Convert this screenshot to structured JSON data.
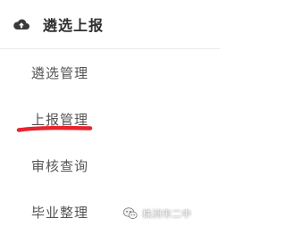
{
  "menu": {
    "header": {
      "icon": "cloud-upload-icon",
      "label": "遴选上报"
    },
    "items": [
      {
        "label": "遴选管理"
      },
      {
        "label": "上报管理",
        "annotated": true
      },
      {
        "label": "审核查询"
      },
      {
        "label": "毕业整理"
      }
    ]
  },
  "annotation": {
    "color": "#e8242f",
    "shape": "underline"
  },
  "watermark": {
    "icon": "wechat-icon",
    "text": "株洲市二中"
  }
}
